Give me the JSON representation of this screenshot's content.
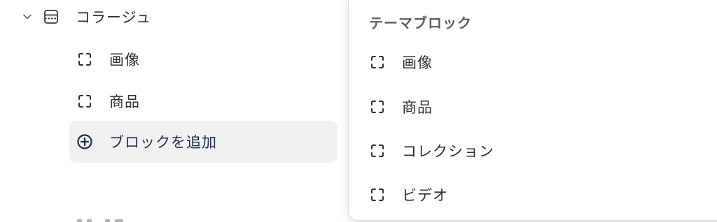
{
  "tree": {
    "section": {
      "label": "コラージュ",
      "expanded": true
    },
    "children": [
      {
        "label": "画像"
      },
      {
        "label": "商品"
      }
    ],
    "add_block_label": "ブロックを追加"
  },
  "popover": {
    "title": "テーマブロック",
    "items": [
      {
        "label": "画像"
      },
      {
        "label": "商品"
      },
      {
        "label": "コレクション"
      },
      {
        "label": "ビデオ"
      }
    ]
  },
  "icons": {
    "chevron": "chevron-down-icon",
    "collage": "collage-layout-icon",
    "block": "block-frame-icon",
    "add": "plus-circle-icon"
  },
  "colors": {
    "text": "#303030",
    "add_block_bg": "#f1f1f1",
    "add_block_text": "#1f2d4a",
    "popover_title": "#5e5e5e"
  }
}
